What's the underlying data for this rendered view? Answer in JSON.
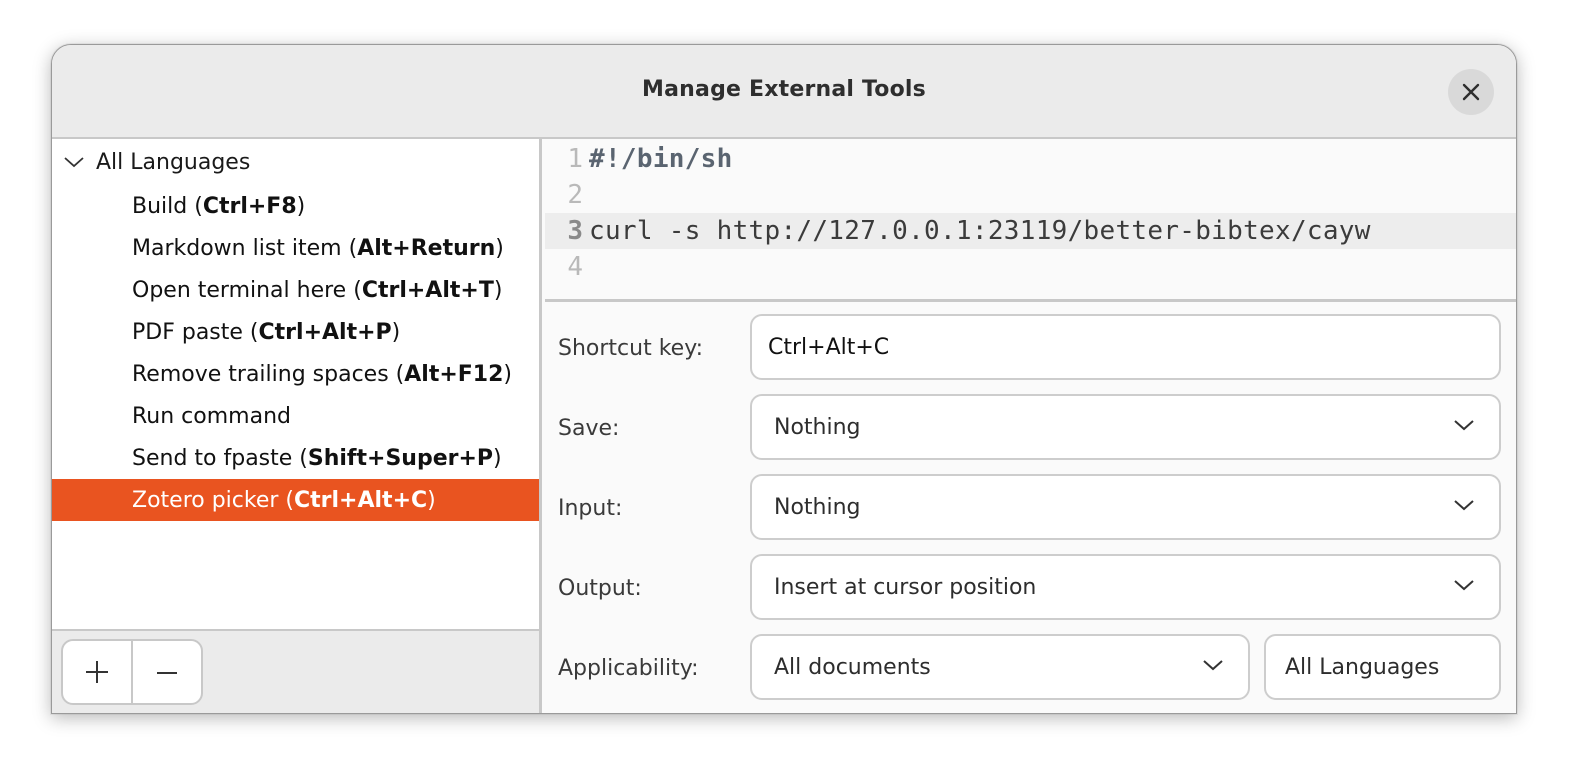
{
  "window": {
    "title": "Manage External Tools",
    "close_icon": "close-icon"
  },
  "tree": {
    "root_label": "All Languages",
    "root_expanded": true,
    "items": [
      {
        "name": "Build",
        "shortcut": "Ctrl+F8",
        "selected": false
      },
      {
        "name": "Markdown list item",
        "shortcut": "Alt+Return",
        "selected": false
      },
      {
        "name": "Open terminal here",
        "shortcut": "Ctrl+Alt+T",
        "selected": false
      },
      {
        "name": "PDF paste",
        "shortcut": "Ctrl+Alt+P",
        "selected": false
      },
      {
        "name": "Remove trailing spaces",
        "shortcut": "Alt+F12",
        "selected": false
      },
      {
        "name": "Run command",
        "shortcut": "",
        "selected": false
      },
      {
        "name": "Send to fpaste",
        "shortcut": "Shift+Super+P",
        "selected": false
      },
      {
        "name": "Zotero picker",
        "shortcut": "Ctrl+Alt+C",
        "selected": true
      }
    ],
    "selection_color": "#e95420"
  },
  "footer": {
    "add_icon": "plus-icon",
    "remove_icon": "minus-icon"
  },
  "editor": {
    "current_line": 3,
    "lines": [
      {
        "number": "1",
        "text": "#!/bin/sh"
      },
      {
        "number": "2",
        "text": ""
      },
      {
        "number": "3",
        "text": "curl -s http://127.0.0.1:23119/better-bibtex/cayw"
      },
      {
        "number": "4",
        "text": ""
      }
    ]
  },
  "form": {
    "shortcut_label": "Shortcut key:",
    "shortcut_value": "Ctrl+Alt+C",
    "save_label": "Save:",
    "save_value": "Nothing",
    "input_label": "Input:",
    "input_value": "Nothing",
    "output_label": "Output:",
    "output_value": "Insert at cursor position",
    "applicability_label": "Applicability:",
    "applicability_value": "All documents",
    "language_value": "All Languages"
  }
}
